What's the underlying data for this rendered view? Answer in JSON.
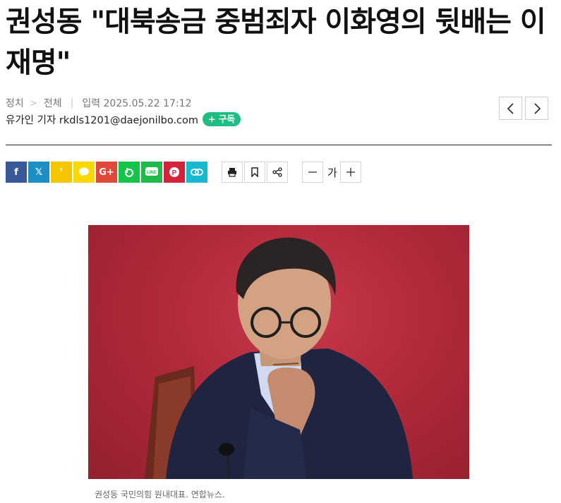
{
  "article": {
    "headline": "권성동 \"대북송금 중범죄자 이화영의 뒷배는 이재명\"",
    "category": "정치",
    "subcategory": "전체",
    "published": "입력 2025.05.22 17:12",
    "author": "유가인 기자 rkdls1201@daejonilbo.com",
    "subscribe_label": "+ 구독"
  },
  "share": {
    "buttons": [
      {
        "name": "facebook-share-button",
        "label": "f",
        "color": "#3b5998"
      },
      {
        "name": "x-share-button",
        "label": "𝕏",
        "color": "#1d8fc4"
      },
      {
        "name": "kakaostory-share-button",
        "label": "❜",
        "color": "#f6c600"
      },
      {
        "name": "kakaotalk-share-button",
        "label": "💬",
        "color": "#f9d800"
      },
      {
        "name": "googleplus-share-button",
        "label": "G+",
        "color": "#e0483a"
      },
      {
        "name": "band-share-button",
        "label": "b",
        "color": "#16c44b"
      },
      {
        "name": "line-share-button",
        "label": "LINE",
        "color": "#21b94c"
      },
      {
        "name": "pinterest-share-button",
        "label": "P",
        "color": "#d3233b"
      },
      {
        "name": "link-copy-button",
        "label": "🔗",
        "color": "#16b9cf"
      }
    ]
  },
  "tools": {
    "font_label": "가"
  },
  "photo": {
    "caption": "권성동 국민의힘 원내대표. 연합뉴스."
  }
}
